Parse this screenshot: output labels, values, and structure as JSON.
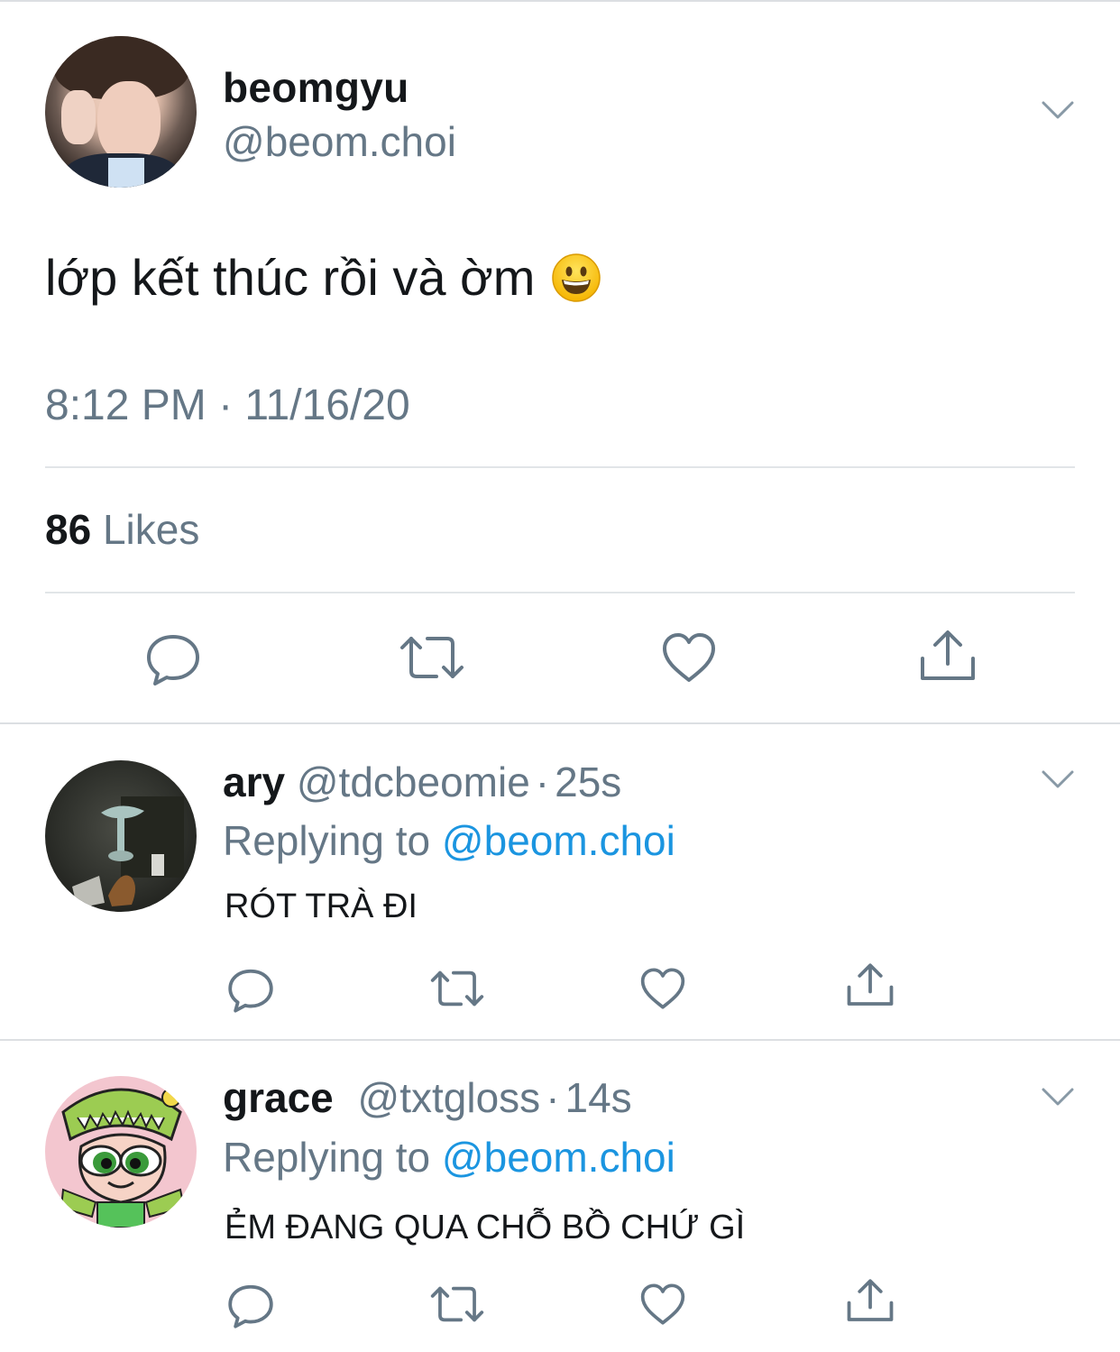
{
  "main_tweet": {
    "display_name": "beomgyu",
    "handle": "@beom.choi",
    "text": "lớp kết thúc rồi và ờm",
    "emoji_icon": "grinning-face-emoji",
    "timestamp": "8:12 PM · 11/16/20",
    "likes_count": "86",
    "likes_label": "Likes"
  },
  "replies": [
    {
      "display_name": "ary",
      "handle": "@tdcbeomie",
      "separator": "·",
      "age": "25s",
      "replying_prefix": "Replying to",
      "replying_to": "@beom.choi",
      "text": "RÓT TRÀ ĐI"
    },
    {
      "display_name": "grace",
      "handle": "@txtgloss",
      "separator": "·",
      "age": "14s",
      "replying_prefix": "Replying to",
      "replying_to": "@beom.choi",
      "text": "ẺM ĐANG QUA CHỖ BỒ CHỨ GÌ"
    }
  ],
  "icons": {
    "reply": "reply-icon",
    "retweet": "retweet-icon",
    "like": "like-icon",
    "share": "share-icon",
    "menu": "chevron-down-icon"
  },
  "colors": {
    "text_primary": "#14171a",
    "text_secondary": "#657786",
    "link": "#1b95e0",
    "icon": "#657786",
    "divider": "#e1e5e8"
  }
}
